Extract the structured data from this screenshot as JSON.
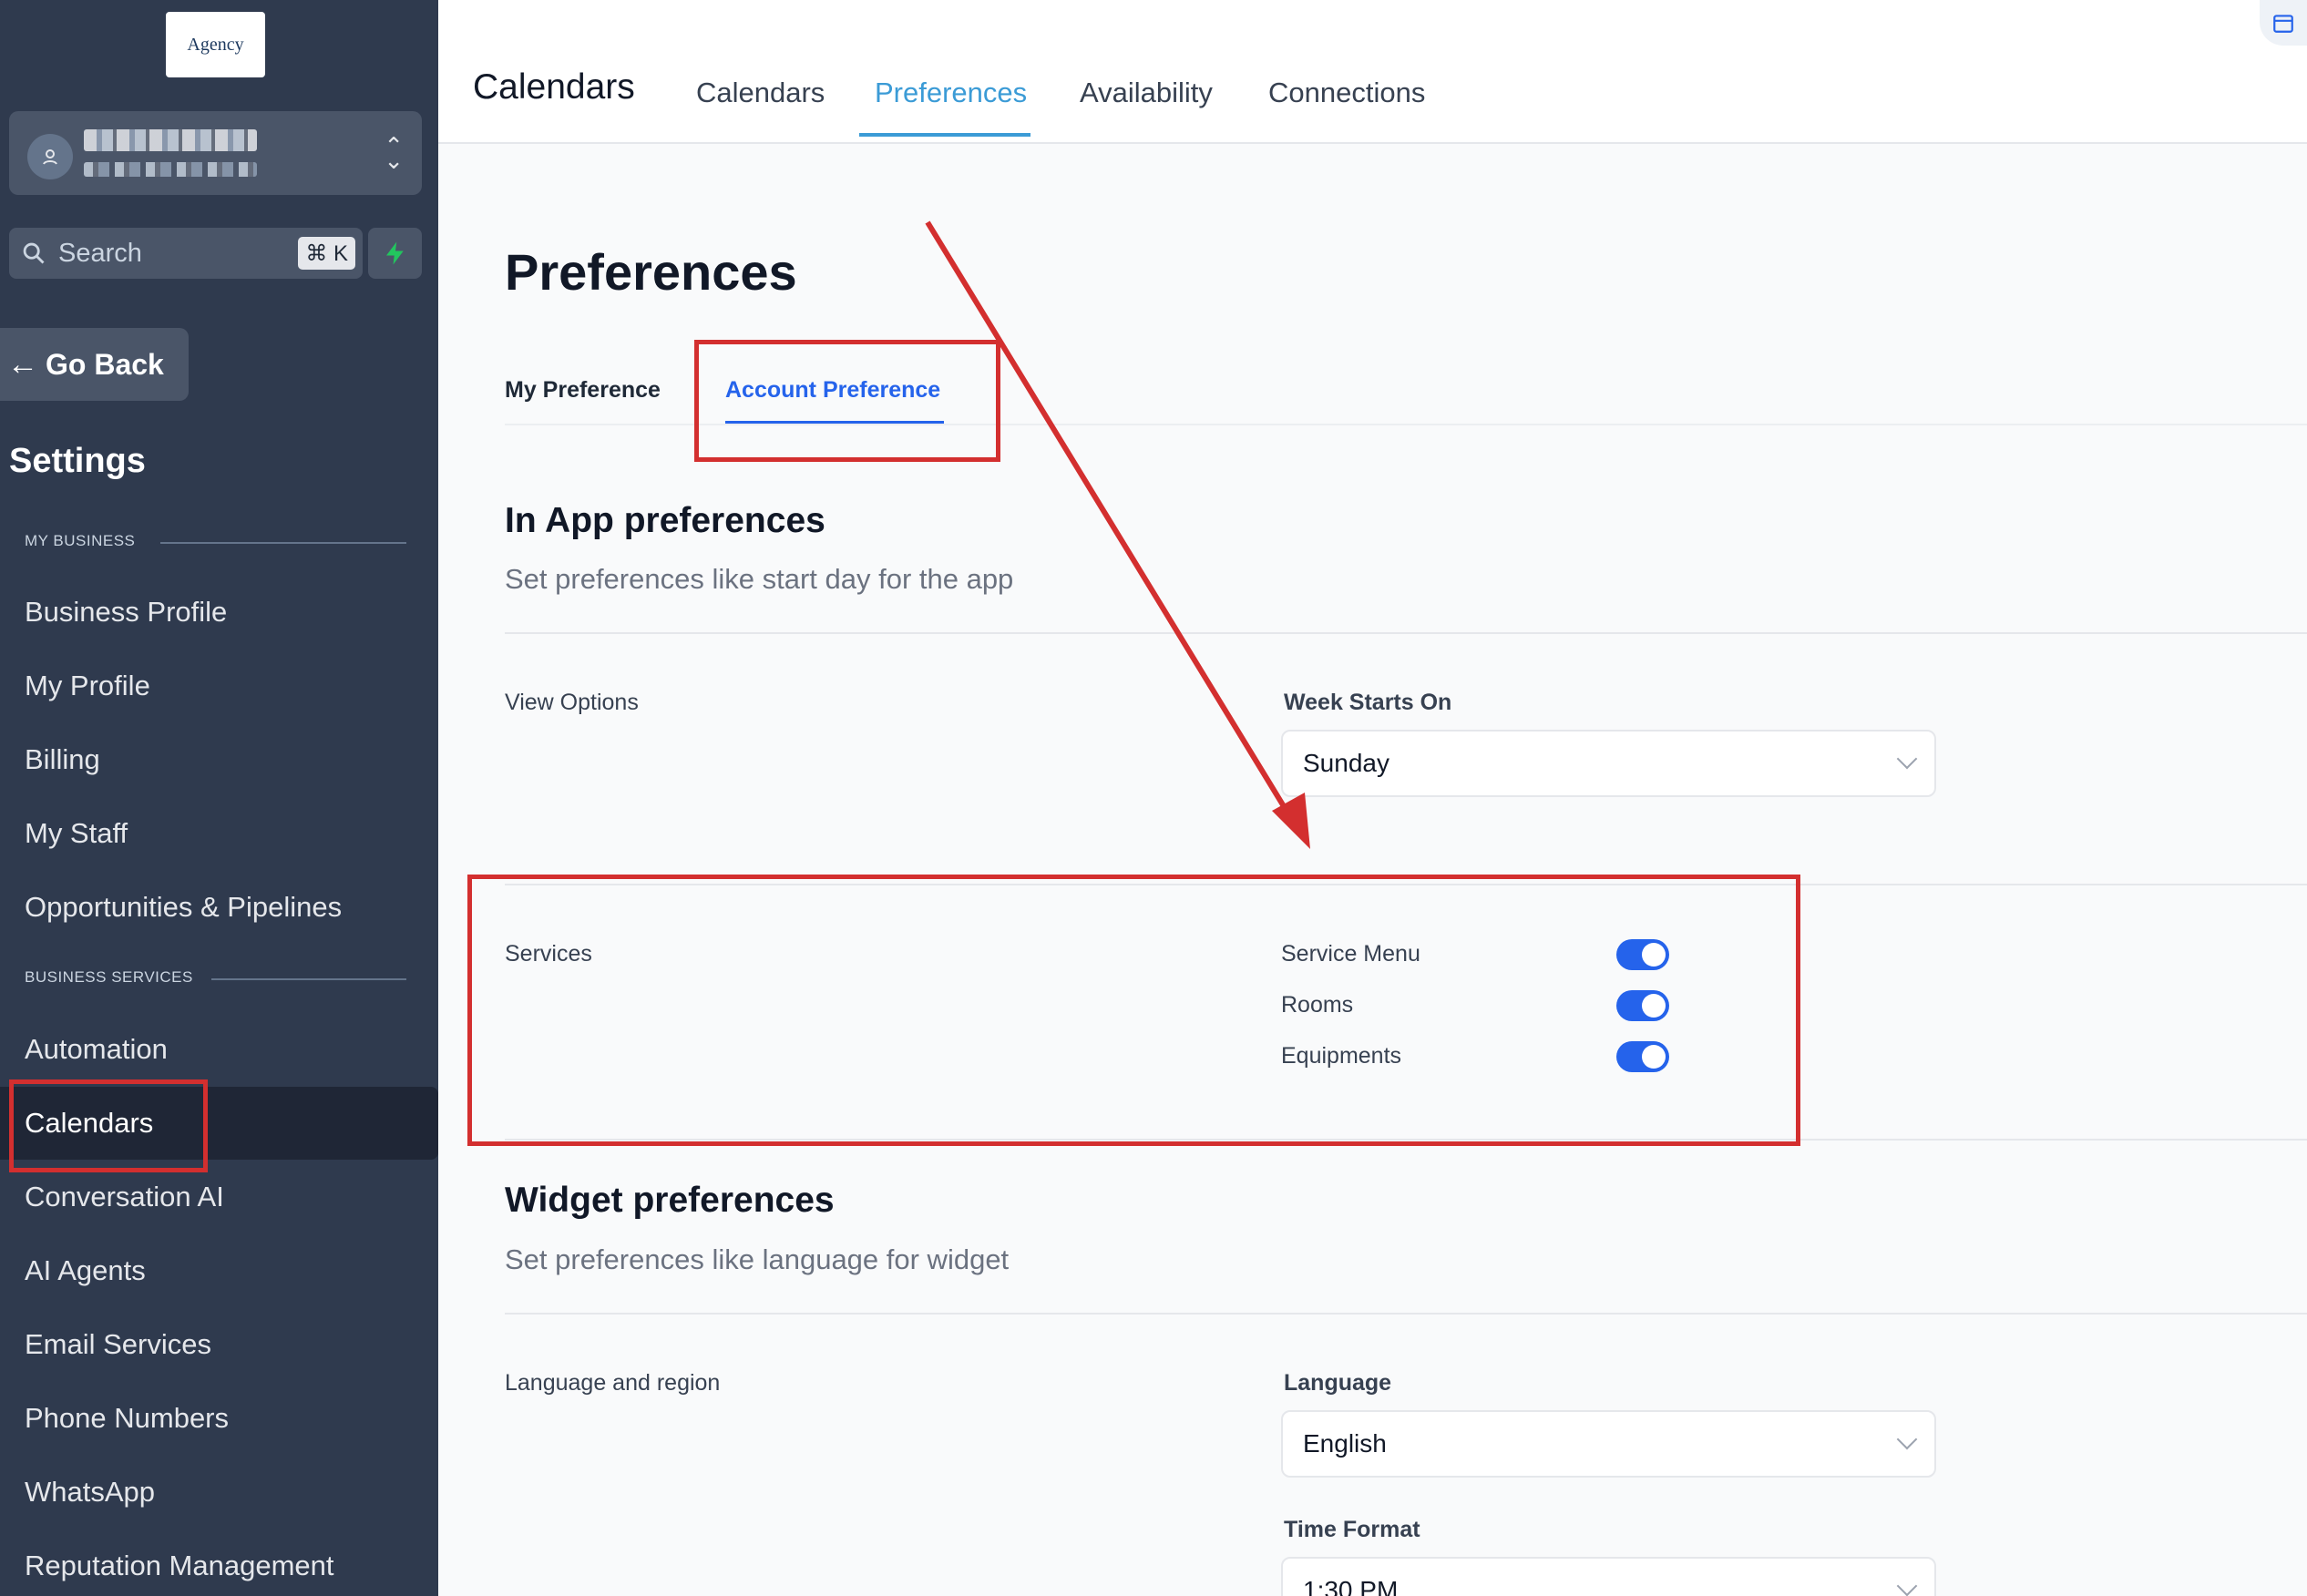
{
  "sidebar": {
    "logo_text": "Agency",
    "search": {
      "label": "Search",
      "shortcut": "⌘ K"
    },
    "go_back": "Go Back",
    "settings_title": "Settings",
    "sections": [
      {
        "label": "MY BUSINESS"
      },
      {
        "label": "BUSINESS SERVICES"
      }
    ],
    "items": [
      {
        "label": "Business Profile"
      },
      {
        "label": "My Profile"
      },
      {
        "label": "Billing"
      },
      {
        "label": "My Staff"
      },
      {
        "label": "Opportunities & Pipelines"
      },
      {
        "label": "Automation"
      },
      {
        "label": "Calendars",
        "active": true
      },
      {
        "label": "Conversation AI"
      },
      {
        "label": "AI Agents"
      },
      {
        "label": "Email Services"
      },
      {
        "label": "Phone Numbers"
      },
      {
        "label": "WhatsApp"
      },
      {
        "label": "Reputation Management"
      }
    ]
  },
  "header": {
    "title": "Calendars",
    "tabs": [
      {
        "label": "Calendars"
      },
      {
        "label": "Preferences",
        "active": true
      },
      {
        "label": "Availability"
      },
      {
        "label": "Connections"
      }
    ]
  },
  "main": {
    "heading": "Preferences",
    "sub_tabs": [
      {
        "label": "My Preference"
      },
      {
        "label": "Account Preference",
        "active": true
      }
    ],
    "in_app": {
      "title": "In App preferences",
      "description": "Set preferences like start day for the app",
      "view_options_label": "View Options",
      "week_starts_label": "Week Starts On",
      "week_starts_value": "Sunday",
      "services_label": "Services",
      "toggles": [
        {
          "label": "Service Menu",
          "on": true
        },
        {
          "label": "Rooms",
          "on": true
        },
        {
          "label": "Equipments",
          "on": true
        }
      ]
    },
    "widget": {
      "title": "Widget preferences",
      "description": "Set preferences like language for widget",
      "lang_region_label": "Language and region",
      "language_label": "Language",
      "language_value": "English",
      "time_format_label": "Time Format",
      "time_format_value": "1:30 PM"
    }
  },
  "colors": {
    "sidebar_bg": "#2f3a4e",
    "accent_blue": "#2563eb",
    "header_tab_active": "#3b9bd6",
    "annotation_red": "#d32f2f",
    "bolt_green": "#22c55e"
  }
}
